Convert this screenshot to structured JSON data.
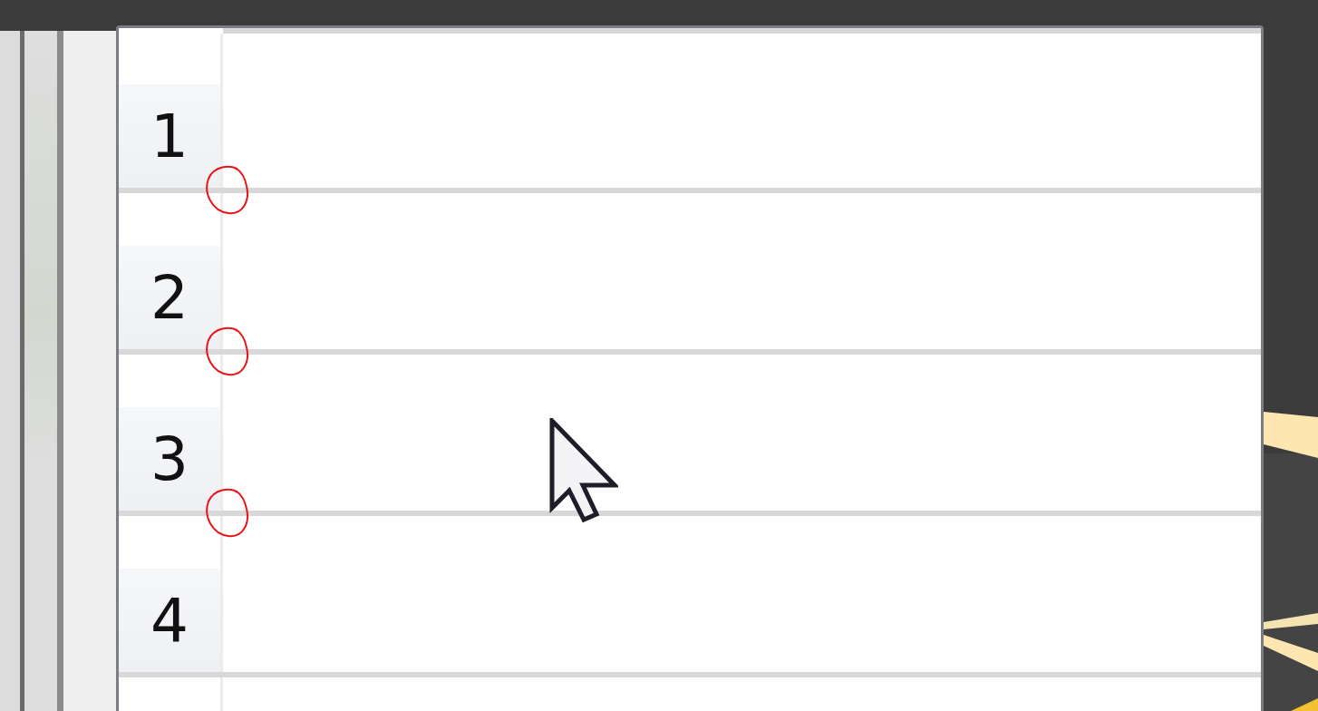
{
  "sheet": {
    "rows": [
      {
        "number": "1",
        "circled": true
      },
      {
        "number": "2",
        "circled": true
      },
      {
        "number": "3",
        "circled": true
      },
      {
        "number": "4",
        "circled": false
      }
    ]
  }
}
